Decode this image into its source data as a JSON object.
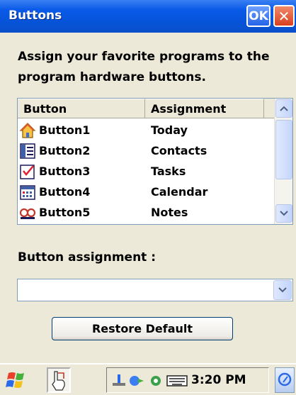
{
  "window": {
    "title": "Buttons",
    "ok_label": "OK",
    "close_label": "✕"
  },
  "instruction": "Assign your favorite programs to the program hardware buttons.",
  "list": {
    "columns": [
      "Button",
      "Assignment"
    ],
    "rows": [
      {
        "button": "Button1",
        "assignment": "Today",
        "icon": "house-icon"
      },
      {
        "button": "Button2",
        "assignment": "Contacts",
        "icon": "contact-card-icon"
      },
      {
        "button": "Button3",
        "assignment": "Tasks",
        "icon": "checkbox-icon"
      },
      {
        "button": "Button4",
        "assignment": "Calendar",
        "icon": "calendar-icon"
      },
      {
        "button": "Button5",
        "assignment": "Notes",
        "icon": "notes-icon"
      }
    ]
  },
  "assignment_label": "Button assignment :",
  "assignment_value": "",
  "restore_label": "Restore Default",
  "taskbar": {
    "clock": "3:20 PM"
  },
  "colors": {
    "titlebar": "#0653d8",
    "ok_button": "#2464e8",
    "close_button": "#d7401f",
    "background": "#ece9d8"
  }
}
